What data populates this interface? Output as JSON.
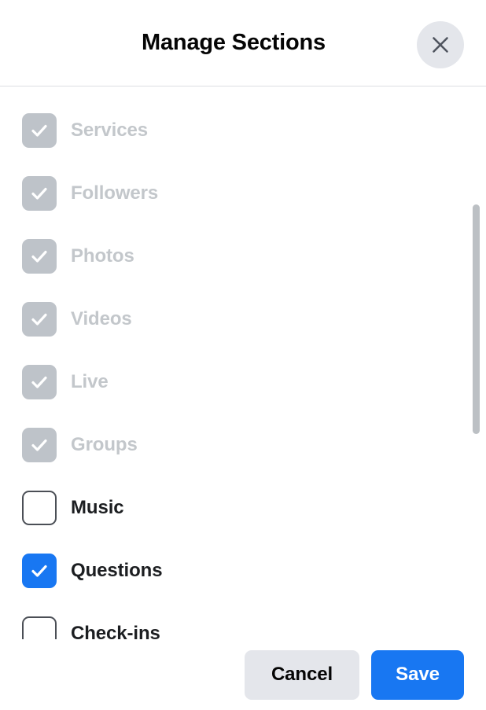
{
  "dialog": {
    "title": "Manage Sections",
    "close_icon": "close-icon"
  },
  "sections": [
    {
      "label": "Services",
      "checked": true,
      "disabled": true
    },
    {
      "label": "Followers",
      "checked": true,
      "disabled": true
    },
    {
      "label": "Photos",
      "checked": true,
      "disabled": true
    },
    {
      "label": "Videos",
      "checked": true,
      "disabled": true
    },
    {
      "label": "Live",
      "checked": true,
      "disabled": true
    },
    {
      "label": "Groups",
      "checked": true,
      "disabled": true
    },
    {
      "label": "Music",
      "checked": false,
      "disabled": false
    },
    {
      "label": "Questions",
      "checked": true,
      "disabled": false
    },
    {
      "label": "Check-ins",
      "checked": false,
      "disabled": false
    }
  ],
  "footer": {
    "cancel_label": "Cancel",
    "save_label": "Save"
  },
  "colors": {
    "accent": "#1877F2",
    "neutral_button": "#E4E6EB",
    "disabled_checkbox": "#BEC3C9",
    "disabled_text": "#C3C7CB",
    "text": "#1C1E21",
    "divider": "#DDDFE2",
    "scrollbar": "#BCC0C4"
  },
  "scrollbar": {
    "visible": true,
    "thumb_name": "scrollbar-thumb"
  }
}
